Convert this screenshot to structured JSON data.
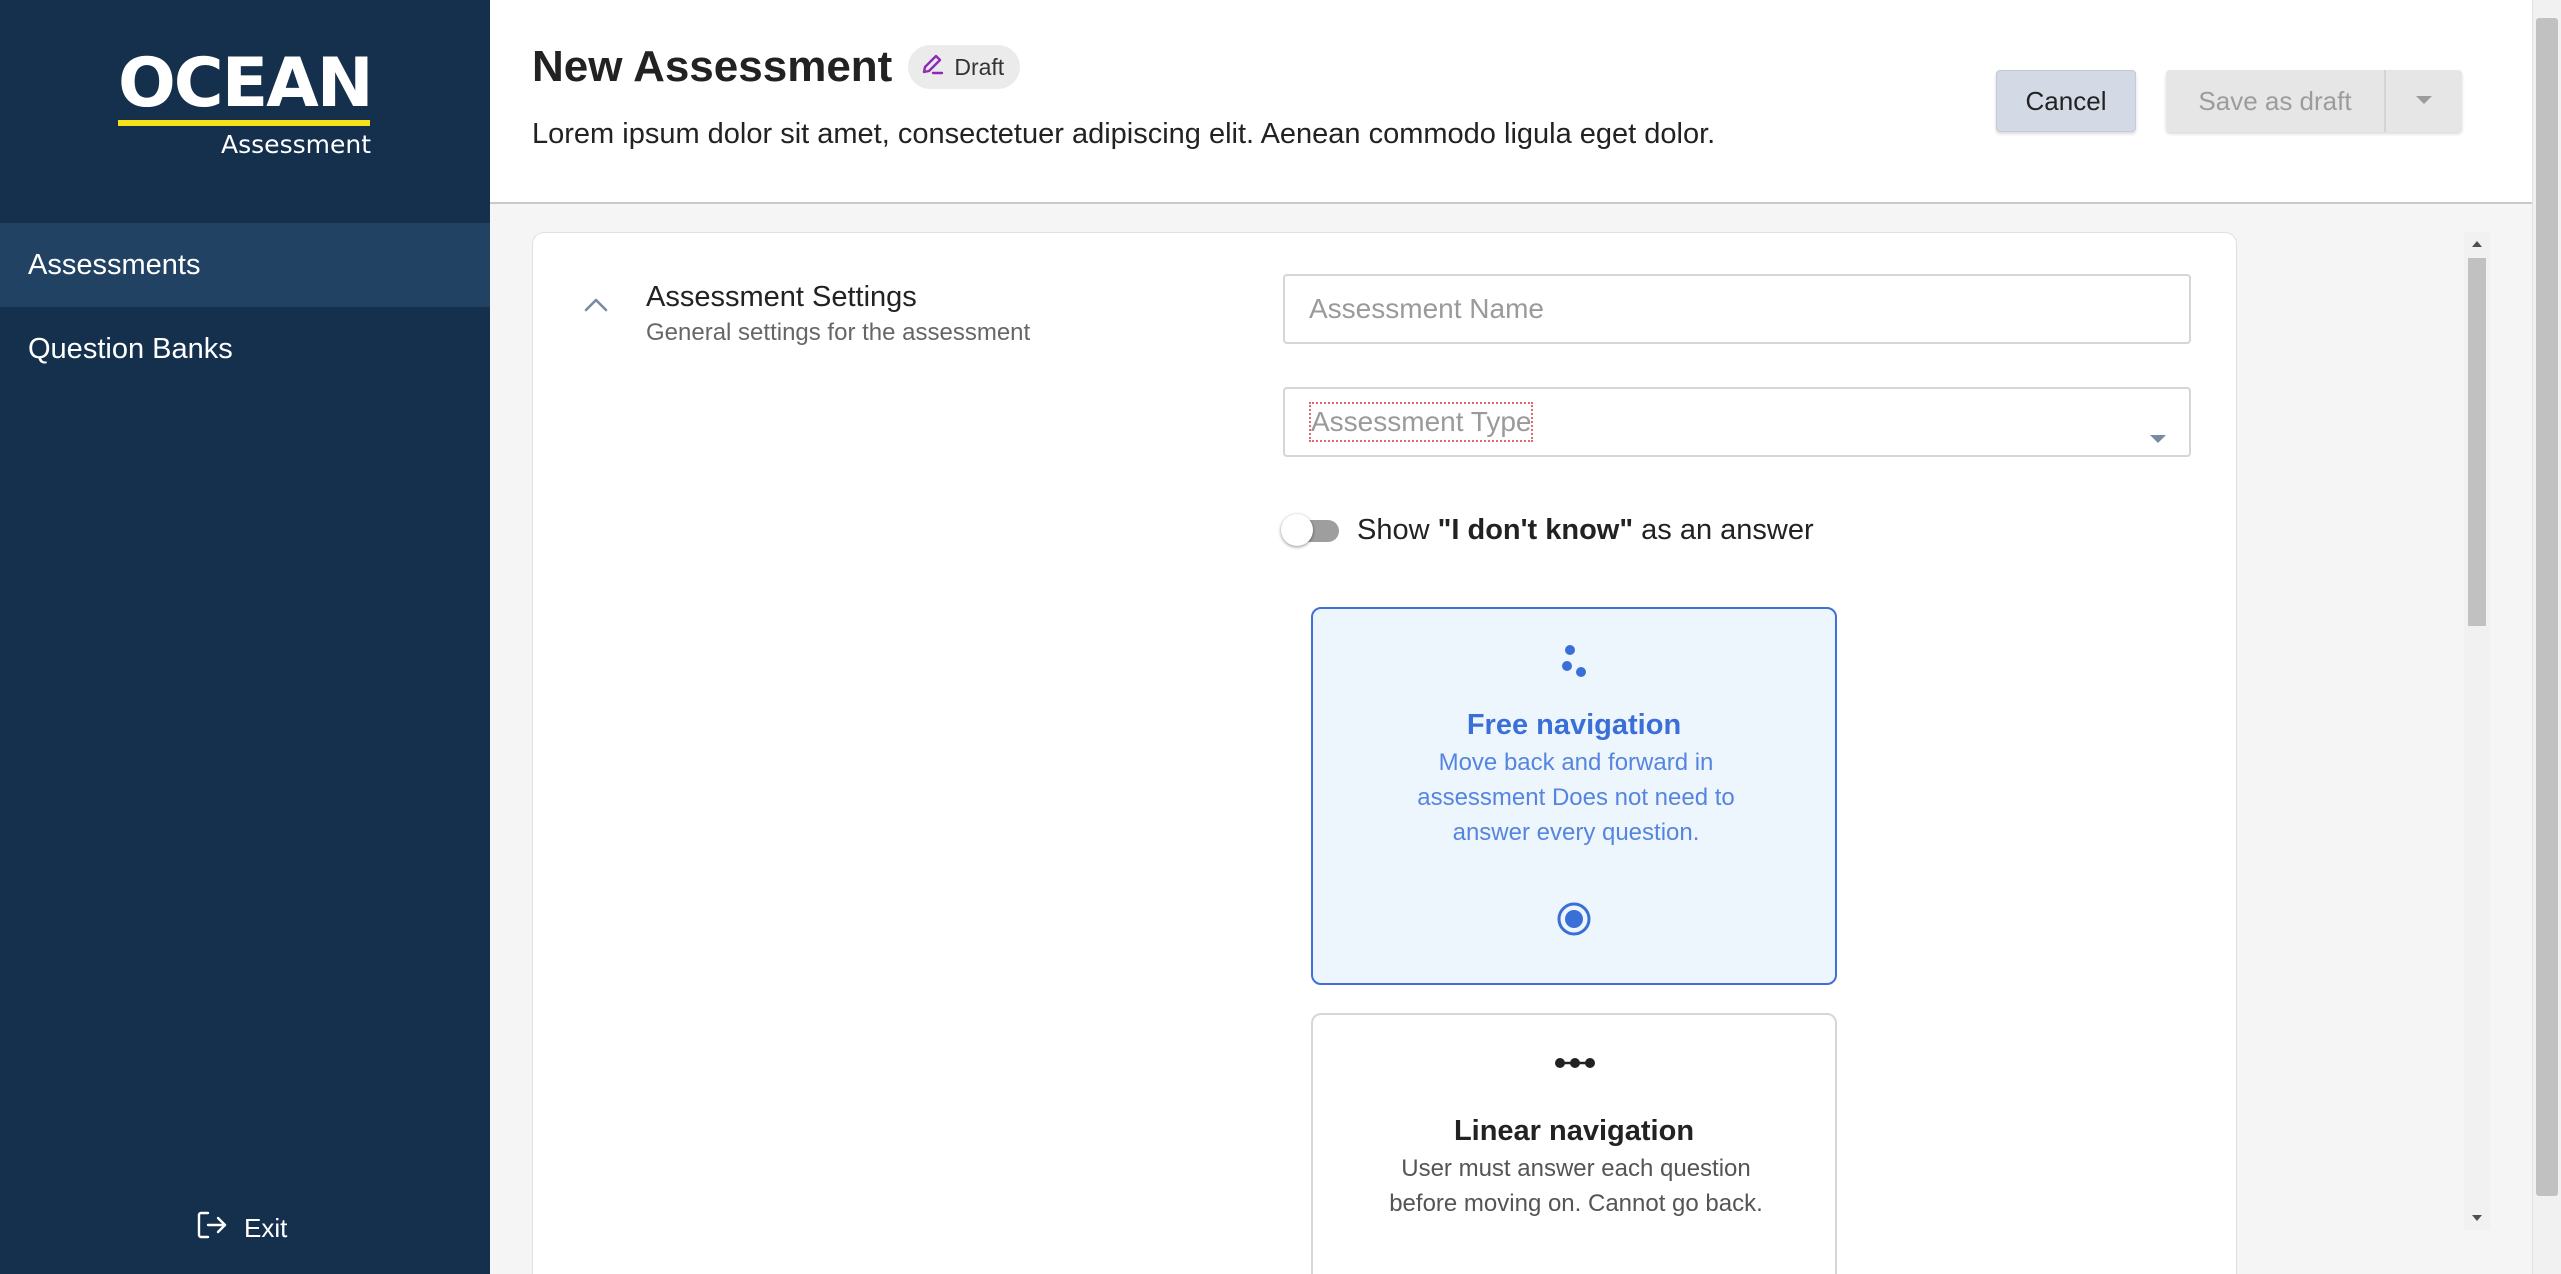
{
  "sidebar": {
    "logo": {
      "word": "OCEAN",
      "sub": "Assessment"
    },
    "items": [
      {
        "label": "Assessments",
        "active": true
      },
      {
        "label": "Question Banks",
        "active": false
      }
    ],
    "exit_label": "Exit"
  },
  "header": {
    "title": "New Assessment",
    "badge": "Draft",
    "description": "Lorem ipsum dolor sit amet, consectetuer adipiscing elit. Aenean commodo ligula eget dolor.",
    "cancel_label": "Cancel",
    "save_label": "Save as draft"
  },
  "settings": {
    "title": "Assessment Settings",
    "subtitle": "General settings for the assessment",
    "name_placeholder": "Assessment Name",
    "type_placeholder": "Assessment Type",
    "toggle": {
      "prefix": "Show ",
      "bold": "\"I don't know\"",
      "suffix": " as an answer",
      "on": false
    },
    "navigation_options": [
      {
        "title": "Free navigation",
        "description": "Move back and forward in assessment Does not need to answer every question.",
        "selected": true
      },
      {
        "title": "Linear navigation",
        "description": "User must answer each question before moving on. Cannot go back.",
        "selected": false
      }
    ]
  },
  "colors": {
    "sidebar_bg": "#14304d",
    "sidebar_active": "#214263",
    "logo_accent": "#f4e11a",
    "primary": "#3b6fd8",
    "badge_icon": "#8e2bb8"
  },
  "icons": {
    "collapse": "chevron-up-icon",
    "badge": "pencil-icon",
    "exit": "logout-icon",
    "free": "scatter-dots-icon",
    "linear": "linked-dots-icon"
  }
}
